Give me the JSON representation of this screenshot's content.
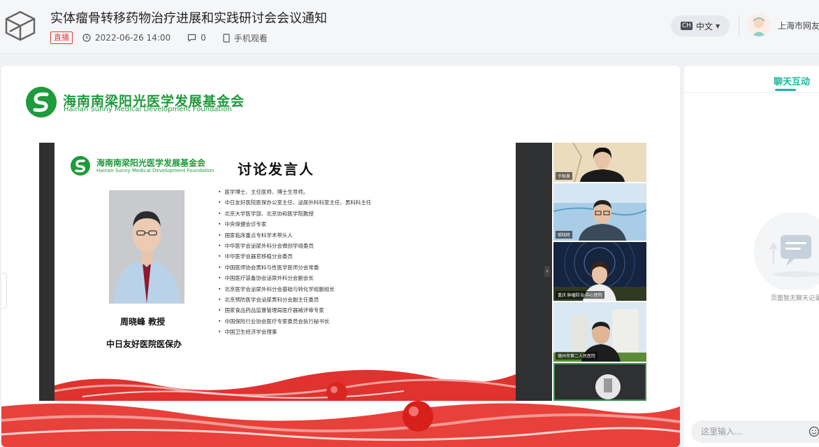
{
  "header": {
    "title": "实体瘤骨转移药物治疗进展和实践研讨会会议通知",
    "live_badge": "直播",
    "datetime": "2022-06-26 14:00",
    "comment_count": "0",
    "mobile_watch": "手机观看",
    "lang_code": "CH",
    "lang_label": "中文",
    "user_name": "上海市网友"
  },
  "video": {
    "foundation_cn": "海南南梁阳光医学发展基金会",
    "foundation_en": "Hainan Sunny Medical Development Foundation",
    "slide": {
      "title": "讨论发言人",
      "speaker_name": "周晓峰 教授",
      "speaker_org": "中日友好医院医保办",
      "credentials": [
        "医学博士、主任医师、博士生导师。",
        "中日友好医院医保办公室主任、泌尿外科科室主任、男科科主任",
        "北京大学医学部、北京协和医学院教授",
        "中央保健会诊专家",
        "国家临床重点专科学术带头人",
        "中华医学会泌尿外科分会微创学组委员",
        "中华医学会器官移植分会委员",
        "中国医师协会男科与性医学医师分会常委",
        "中国医疗装备协会泌尿外科分会副会长",
        "北京医学会泌尿外科分会基础与转化学组副组长",
        "北京预防医学会泌尿男科分会副主任委员",
        "国家食品药品监督管理局医疗器械评审专家",
        "中国保险行业协会医疗专家委员会执行秘书长",
        "中国卫生经济学会理事"
      ]
    },
    "participants": [
      {
        "label": "于秋美"
      },
      {
        "label": "郝晓晖"
      },
      {
        "label": "重庆·肿瘤防治·中心医院"
      },
      {
        "label": "德州市第二人民医院"
      },
      {
        "label": ""
      }
    ]
  },
  "chat": {
    "tab_label": "聊天互动",
    "empty_text": "页面暂无聊天记录",
    "input_placeholder": "这里输入..."
  },
  "colors": {
    "accent": "#1cb79a",
    "live_red": "#e23b3b",
    "foundation_green": "#1f9a3c",
    "wave_red": "#e0322e"
  }
}
